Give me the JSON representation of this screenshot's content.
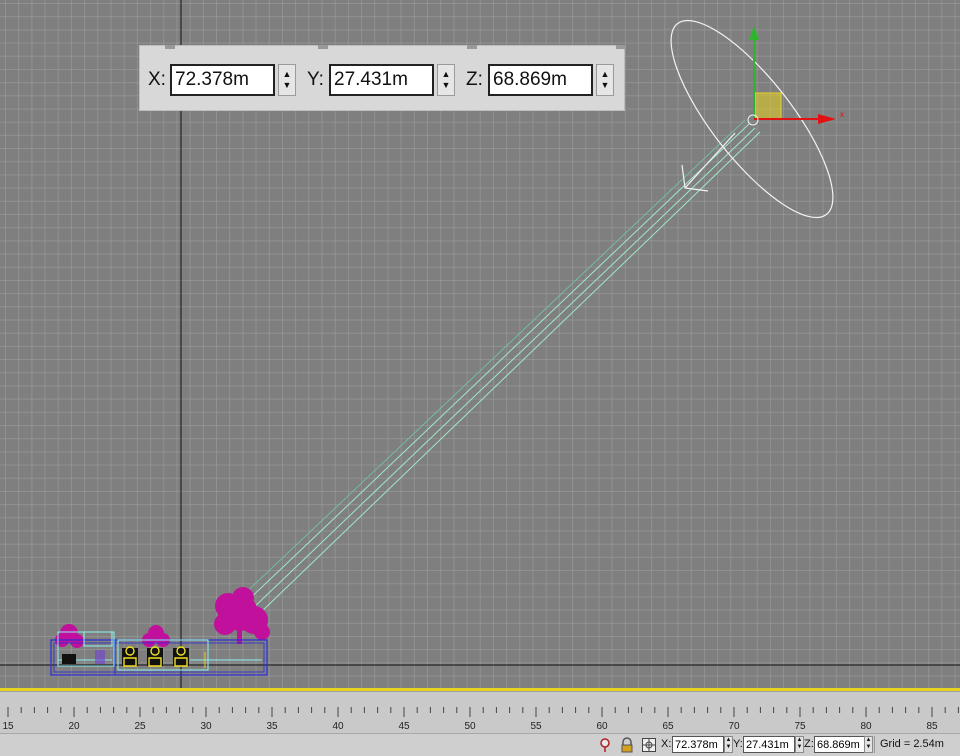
{
  "toolbar": {
    "x_label": "X:",
    "x_value": "72.378m",
    "y_label": "Y:",
    "y_value": "27.431m",
    "z_label": "Z:",
    "z_value": "68.869m"
  },
  "status": {
    "x_label": "X:",
    "x_value": "72.378m",
    "y_label": "Y:",
    "y_value": "27.431m",
    "z_label": "Z:",
    "z_value": "68.869m",
    "grid_text": "Grid = 2.54m"
  },
  "ruler": {
    "labels": [
      "15",
      "20",
      "25",
      "30",
      "35",
      "40",
      "45",
      "50",
      "55",
      "60",
      "65",
      "70",
      "75",
      "80",
      "85"
    ]
  },
  "gizmo": {
    "axis_x_label": "x"
  },
  "colors": {
    "viewport_bg": "#7f7f7f",
    "grid_line": "#a0a0a0",
    "gizmo_x": "#e21010",
    "gizmo_y": "#2cb52c",
    "gizmo_plane": "#e6d21e",
    "light_beam": "#9fe8c8",
    "foliage": "#c0109c",
    "selection_box": "#2a2ad8"
  },
  "icons": [
    "pin-icon",
    "lock-icon",
    "absolute-mode-icon"
  ]
}
